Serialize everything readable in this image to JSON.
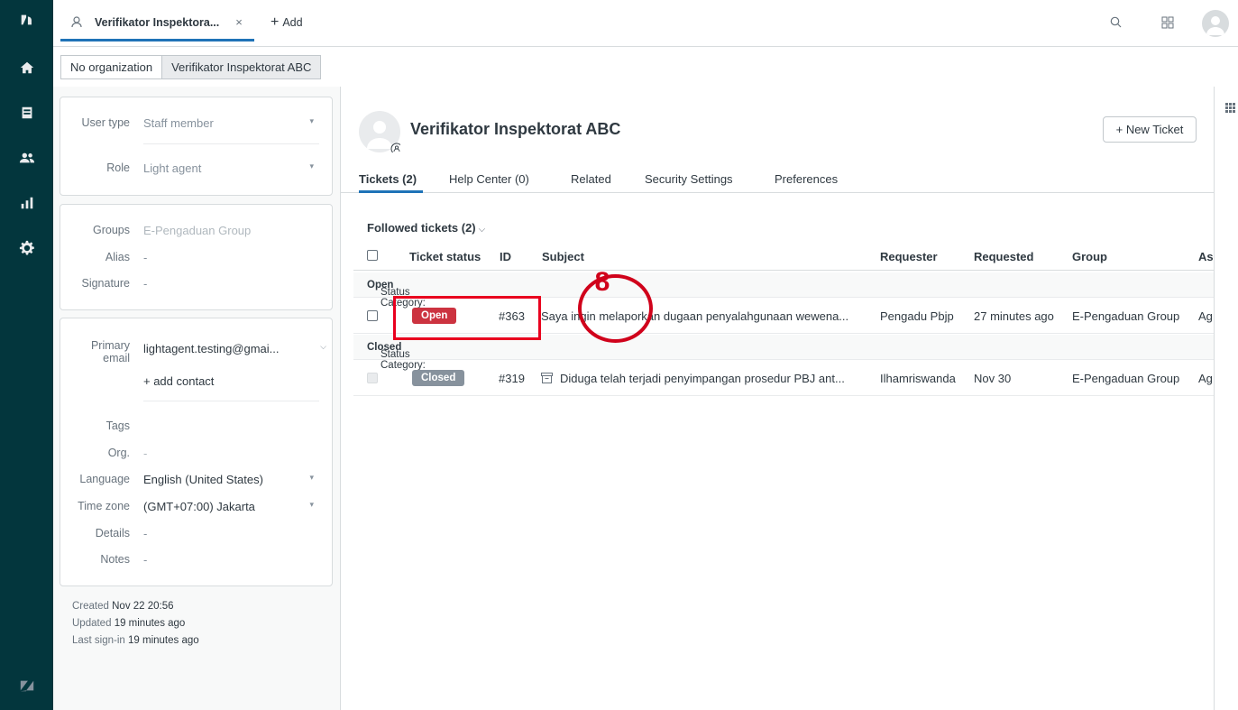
{
  "topbar": {
    "user_tab_label": "Verifikator Inspektora...",
    "close_glyph": "×",
    "add_label": "Add"
  },
  "breadcrumb": [
    "No organization",
    "Verifikator Inspektorat ABC"
  ],
  "properties": {
    "user_type": {
      "label": "User type",
      "value": "Staff member"
    },
    "role": {
      "label": "Role",
      "value": "Light agent"
    },
    "groups": {
      "label": "Groups",
      "value": "E-Pengaduan Group"
    },
    "alias": {
      "label": "Alias",
      "value": "-"
    },
    "signature": {
      "label": "Signature",
      "value": "-"
    },
    "primary_email": {
      "label_line1": "Primary",
      "label_line2": "email",
      "value": "lightagent.testing@gmai..."
    },
    "add_contact": "+ add contact",
    "tags": {
      "label": "Tags",
      "value": ""
    },
    "org": {
      "label": "Org.",
      "value": "-"
    },
    "language": {
      "label": "Language",
      "value": "English (United States)"
    },
    "time_zone": {
      "label": "Time zone",
      "value": "(GMT+07:00) Jakarta"
    },
    "details": {
      "label": "Details",
      "value": "-"
    },
    "notes": {
      "label": "Notes",
      "value": "-"
    }
  },
  "meta": {
    "created_label": "Created",
    "created_value": "Nov 22 20:56",
    "updated_label": "Updated",
    "updated_value": "19 minutes ago",
    "last_signin_label": "Last sign-in",
    "last_signin_value": "19 minutes ago"
  },
  "user": {
    "name": "Verifikator Inspektorat ABC",
    "new_ticket_label": "+ New Ticket"
  },
  "tabs": [
    "Tickets (2)",
    "Help Center (0)",
    "Related",
    "Security Settings",
    "Preferences"
  ],
  "tickets": {
    "view_label": "Followed tickets (2)",
    "columns": [
      "Ticket status",
      "ID",
      "Subject",
      "Requester",
      "Requested",
      "Group",
      "As"
    ],
    "group_prefix": "Status Category:",
    "groups": [
      {
        "name": "Open",
        "rows": [
          {
            "status": "Open",
            "status_color": "#cc3340",
            "id": "#363",
            "subject": "Saya ingin melaporkan dugaan penyalahgunaan wewena...",
            "requester": "Pengadu Pbjp",
            "requested": "27 minutes ago",
            "group": "E-Pengaduan Group",
            "assignee": "Ag"
          }
        ]
      },
      {
        "name": "Closed",
        "rows": [
          {
            "status": "Closed",
            "status_color": "#87929d",
            "id": "#319",
            "subject": "Diduga telah terjadi penyimpangan prosedur PBJ ant...",
            "requester": "Ilhamriswanda",
            "requested": "Nov 30",
            "group": "E-Pengaduan Group",
            "assignee": "Ag"
          }
        ]
      }
    ]
  },
  "annotation": {
    "number": "8",
    "color": "#d0021b"
  },
  "colors": {
    "nav_bg": "#03363d",
    "accent": "#1f73b7"
  }
}
